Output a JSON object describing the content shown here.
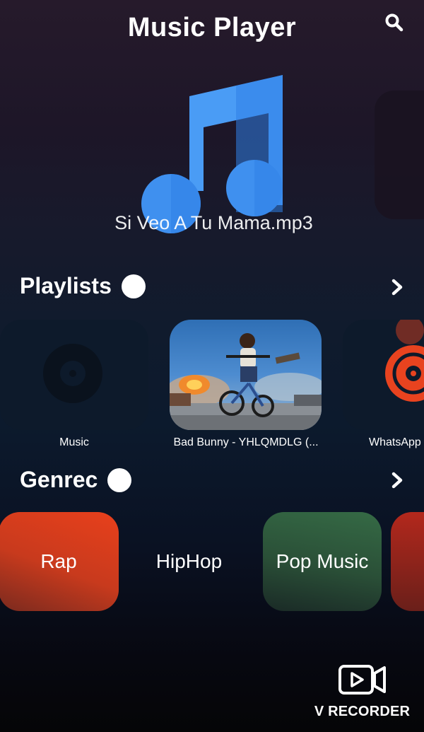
{
  "app": {
    "title": "Music Player"
  },
  "now_playing": {
    "track_name": "Si Veo A Tu Mama.mp3"
  },
  "playlists": {
    "header": "Playlists",
    "items": [
      {
        "label": "Music"
      },
      {
        "label": "Bad Bunny - YHLQMDLG (..."
      },
      {
        "label": "WhatsApp"
      }
    ]
  },
  "genres": {
    "header": "Genrec",
    "items": [
      {
        "label": "Rap",
        "color": "#e8401c"
      },
      {
        "label": "HipHop",
        "color": ""
      },
      {
        "label": "Pop Music",
        "color": "#2f5a3c"
      },
      {
        "label": "",
        "color": "#b3281c"
      }
    ]
  },
  "watermark": {
    "text": "V RECORDER"
  },
  "icons": {
    "search": "search-icon",
    "chevron": "chevron-right-icon",
    "note": "music-note-icon",
    "recorder": "video-recorder-icon",
    "vinyl": "vinyl-icon"
  },
  "colors": {
    "note_light": "#4a9cf5",
    "note_dark": "#2f7fe6",
    "whatsapp_vinyl": "#e8431f"
  }
}
